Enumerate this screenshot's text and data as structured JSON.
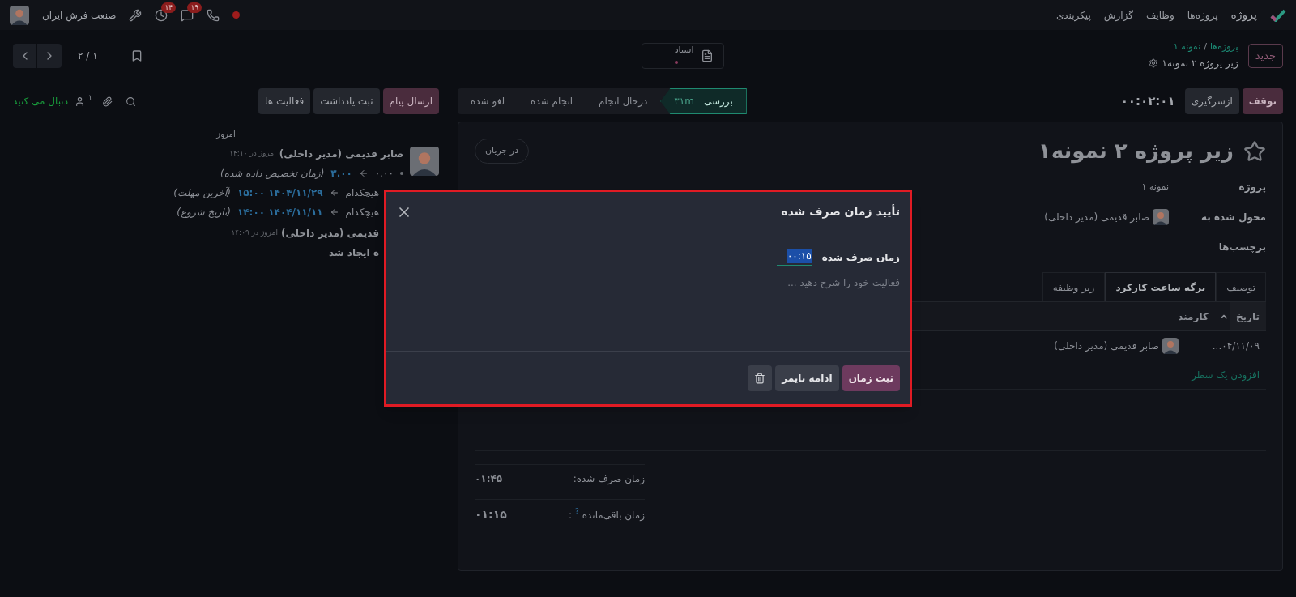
{
  "navbar": {
    "app": "پروژه",
    "menu": [
      "پروژه‌ها",
      "وظایف",
      "گزارش",
      "پیکربندی"
    ],
    "company": "صنعت فرش ایران",
    "activity_badge": "۱۴",
    "messages_badge": "۱۹"
  },
  "control_panel": {
    "new_button": "جدید",
    "breadcrumb": [
      "پروژه‌ها",
      "نمونه ۱"
    ],
    "breadcrumb_separator": "/",
    "record_name": "زیر پروژه ۲ نمونه۱",
    "documents": "اسناد",
    "pager": "۱ / ۲"
  },
  "timer": {
    "stop": "توقف",
    "resume": "ازسرگیری",
    "value": "۰۰:۰۲:۰۱"
  },
  "stages": [
    {
      "label": "بررسی",
      "duration": "۳۱m",
      "selected": true
    },
    {
      "label": "درحال انجام",
      "selected": false
    },
    {
      "label": "انجام شده",
      "selected": false
    },
    {
      "label": "لغو شده",
      "selected": false
    }
  ],
  "form": {
    "title": "زیر پروژه ۲ نمونه۱",
    "badge": "در جریان",
    "fields": [
      {
        "label": "پروژه",
        "value": "نمونه ۱",
        "kind": "text"
      },
      {
        "label": "محول شده به",
        "value": "صابر قدیمی (مدیر داخلی)",
        "kind": "user"
      },
      {
        "label": "برچسب‌ها",
        "kind": "tags"
      }
    ],
    "tabs": [
      {
        "label": "توصیف",
        "selected": false
      },
      {
        "label": "برگه ساعت کارکرد",
        "selected": true
      },
      {
        "label": "زیر-وظیفه",
        "selected": false
      }
    ],
    "table": {
      "columns": [
        "تاریخ",
        "کارمند"
      ],
      "rows": [
        {
          "date": "۰۴/۱۱/۰۹...",
          "employee": "صابر قدیمی (مدیر داخلی)"
        }
      ],
      "add_line": "افزودن یک سطر"
    },
    "totals": [
      {
        "label": "زمان صرف شده:",
        "value": "۰۱:۴۵"
      },
      {
        "label": "زمان باقی‌مانده",
        "help": "?",
        "colon": ":",
        "value": "۰۱:۱۵"
      }
    ]
  },
  "chatter": {
    "buttons": [
      {
        "label": "ارسال پیام",
        "selected": true
      },
      {
        "label": "ثبت یادداشت",
        "selected": false
      },
      {
        "label": "فعالیت ها",
        "selected": false
      }
    ],
    "followers": "۱",
    "follow": "دنبال می کنید",
    "day": "امروز",
    "messages": [
      {
        "author": "صابر قدیمی (مدیر داخلی)",
        "time": "امروز در ۱۴:۱۰",
        "avatar": true,
        "tracking": [
          {
            "old": "۰.۰۰",
            "new": "۳.۰۰",
            "field": "(زمان تخصیص داده شده)",
            "bullet": true
          },
          {
            "old": "هیچکدام",
            "new": "۱۴۰۴/۱۱/۲۹ ۱۵:۰۰",
            "field": "(آخرین مهلت)",
            "bullet": false
          },
          {
            "old": "هیچکدام",
            "new": "۱۴۰۴/۱۱/۱۱ ۱۴:۰۰",
            "field": "(تاریخ شروع)",
            "bullet": false
          }
        ]
      },
      {
        "author": "قدیمی (مدیر داخلی)",
        "time": "امروز در ۱۴:۰۹",
        "body": "ه ایجاد شد"
      }
    ]
  },
  "dialog": {
    "title": "تأیید زمان صرف شده",
    "field_label": "زمان صرف شده",
    "field_value": "۰۰:۱۵",
    "placeholder": "فعالیت خود را شرح دهید ...",
    "buttons": [
      {
        "label": "ثبت زمان",
        "kind": "primary"
      },
      {
        "label": "ادامه تایمر",
        "kind": "secondary"
      },
      {
        "kind": "delete"
      }
    ]
  }
}
